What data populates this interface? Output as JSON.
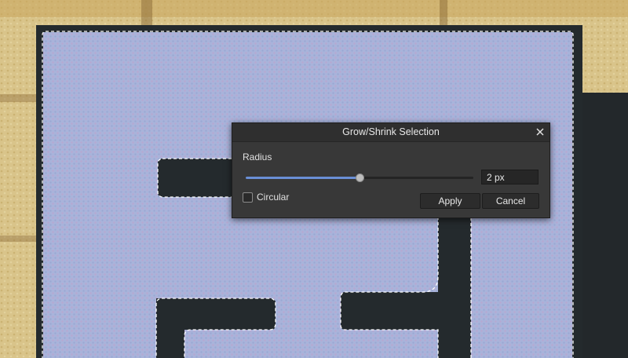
{
  "dialog": {
    "title": "Grow/Shrink Selection",
    "close_icon": "close-icon",
    "radius_label": "Radius",
    "radius_value": "2 px",
    "slider_fraction": 0.5,
    "circular_label": "Circular",
    "circular_checked": false,
    "apply_label": "Apply",
    "cancel_label": "Cancel"
  },
  "colors": {
    "dialog_bg": "#383838",
    "slider_accent": "#6a8fd6",
    "selection_fill": "#a9b3da",
    "dark_stroke": "#242a2d"
  }
}
